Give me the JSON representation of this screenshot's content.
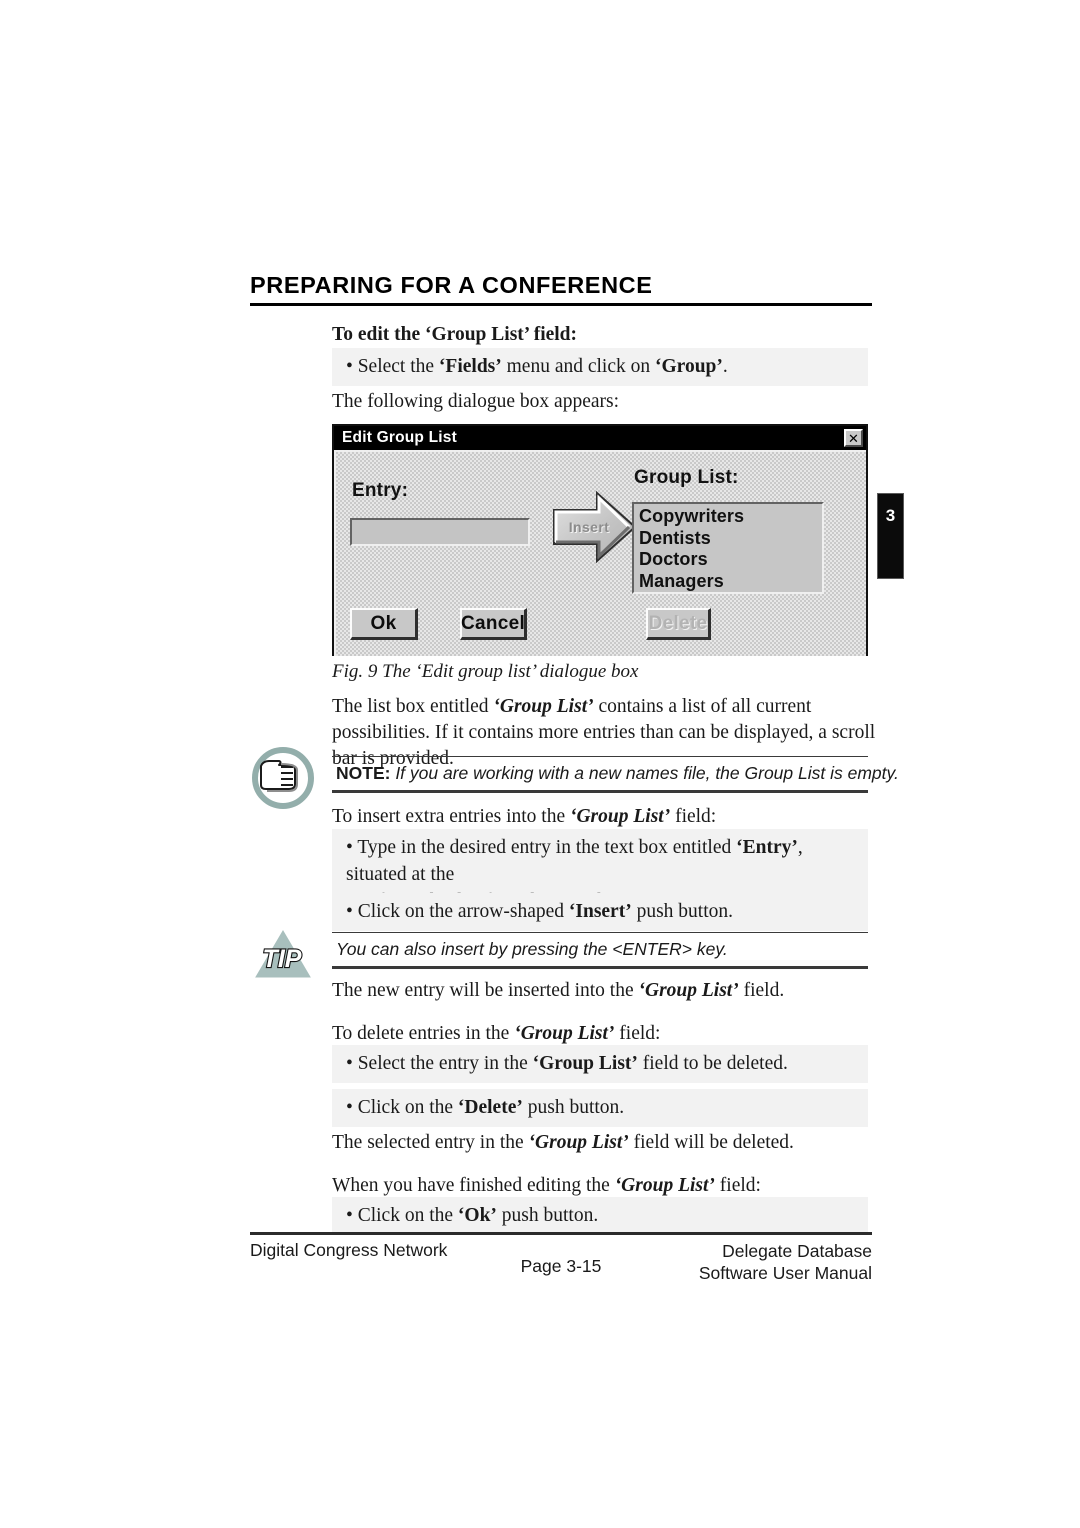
{
  "header": {
    "chapter_title": "PREPARING FOR A CONFERENCE"
  },
  "content": {
    "lead_edit": "To edit the ‘Group List’ field:",
    "bullet_select_fields_pre": "• Select the ",
    "bullet_select_fields_em1": "‘Fields’",
    "bullet_select_fields_mid": " menu and click on ",
    "bullet_select_fields_em2": "‘Group’",
    "bullet_select_fields_post": ".",
    "following_dialogue": "The following dialogue box appears:",
    "figure_caption": "Fig. 9 The ‘Edit group list’ dialogue box",
    "listbox_para_line1_pre": "The list box entitled ",
    "listbox_para_em": "‘Group List’",
    "listbox_para_line1_post": " contains a list of all current possibilities. If",
    "listbox_para_line2": "it contains more entries than can be displayed, a scroll bar is provided.",
    "note_label": "NOTE:",
    "note_text": " If you are working with a new names file, the Group List is empty.",
    "lead_insert_pre": "To insert extra entries into the ",
    "lead_insert_em": "‘Group List’",
    "lead_insert_post": " field:",
    "bullet_type_pre": "• Type in the desired entry in the text box entitled ",
    "bullet_type_em": "‘Entry’",
    "bullet_type_post": ", situated at the",
    "bullet_type_line2": "left-hand side of the dialogue box.",
    "bullet_click_insert_pre": "• Click on the arrow-shaped ",
    "bullet_click_insert_em": "‘Insert’",
    "bullet_click_insert_post": " push button.",
    "tip_text": "You can also insert by pressing the <ENTER> key.",
    "new_entry_pre": "The new entry will be inserted into the ",
    "new_entry_em": "‘Group List’",
    "new_entry_post": " field.",
    "lead_delete_pre": "To delete entries in the ",
    "lead_delete_em": "‘Group List’",
    "lead_delete_post": " field:",
    "bullet_select_entry_pre": "• Select the entry in the ",
    "bullet_select_entry_em": "‘Group List’",
    "bullet_select_entry_post": " field to be deleted.",
    "bullet_click_delete_pre": "• Click on the ",
    "bullet_click_delete_em": "‘Delete’",
    "bullet_click_delete_post": " push button.",
    "deleted_pre": "The selected entry in the ",
    "deleted_em": "‘Group List’",
    "deleted_post": " field will be deleted.",
    "finished_pre": "When you have finished editing the ",
    "finished_em": "‘Group List’",
    "finished_post": " field:",
    "bullet_click_ok_pre": "• Click on the ",
    "bullet_click_ok_em": "‘Ok’",
    "bullet_click_ok_post": " push button."
  },
  "thumb_tab": {
    "chapter_number": "3"
  },
  "dialog": {
    "title": "Edit Group List",
    "close_glyph": "✕",
    "entry_label": "Entry:",
    "entry_value": "",
    "grouplist_label": "Group List:",
    "insert_button_label": "Insert",
    "group_list_items": [
      "Copywriters",
      "Dentists",
      "Doctors",
      "Managers"
    ],
    "buttons": {
      "ok": "Ok",
      "cancel": "Cancel",
      "delete": "Delete"
    }
  },
  "footer": {
    "left": "Digital Congress Network",
    "center": "Page 3-15",
    "right_line1": "Delegate Database",
    "right_line2": "Software User Manual"
  },
  "colors": {
    "band_background": "#f2f2f2",
    "dialog_face": "#c8c8c8",
    "titlebar": "#000000",
    "icon_teal": "#93aeab",
    "rule": "#2b2b2b"
  }
}
